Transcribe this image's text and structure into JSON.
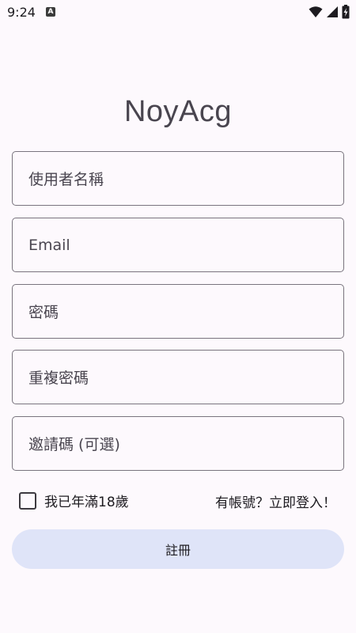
{
  "status_bar": {
    "time": "9:24",
    "notification_icon": "a-badge-icon",
    "icons": [
      "wifi-icon",
      "signal-icon",
      "battery-charging-icon"
    ]
  },
  "app": {
    "title": "NoyAcg"
  },
  "form": {
    "username_label": "使用者名稱",
    "email_label": "Email",
    "password_label": "密碼",
    "confirm_password_label": "重複密碼",
    "invite_code_label": "邀請碼 (可選)"
  },
  "age_confirm": {
    "label": "我已年滿18歲",
    "checked": false
  },
  "login_link": "有帳號？立即登入！",
  "register_button": {
    "label": "註冊"
  },
  "colors": {
    "background": "#fdf9fd",
    "outline": "#79747e",
    "button_bg": "#dfe4f8",
    "title": "#49454f"
  }
}
